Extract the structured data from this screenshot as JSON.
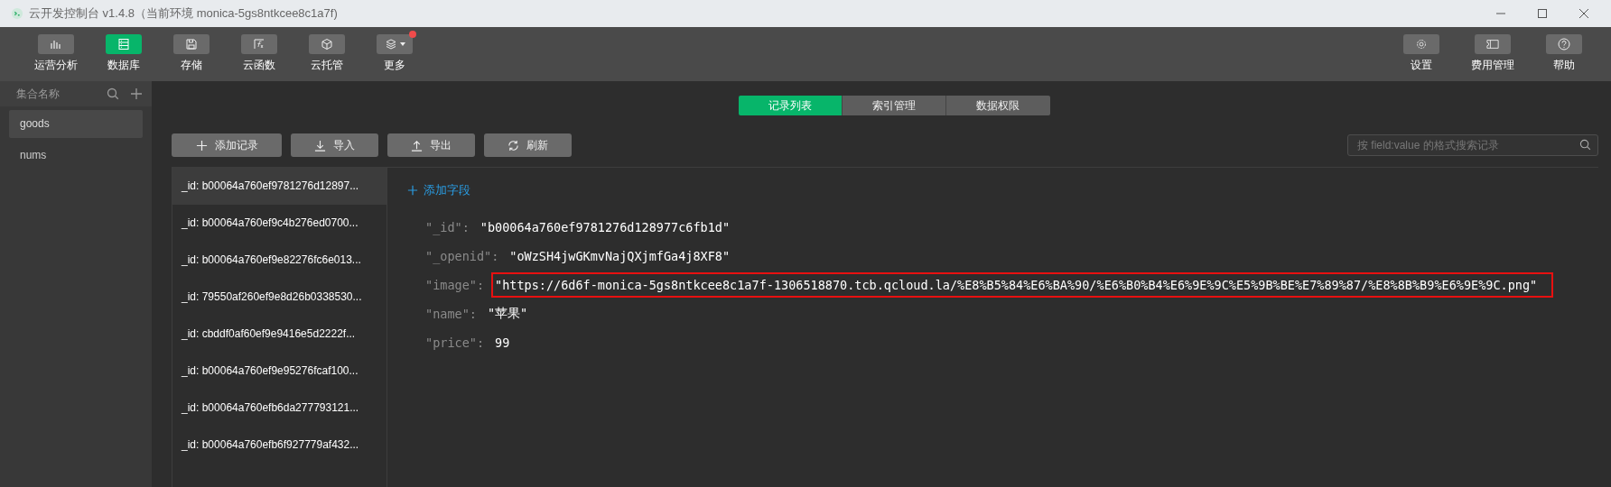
{
  "window": {
    "title": "云开发控制台 v1.4.8（当前环境 monica-5gs8ntkcee8c1a7f)"
  },
  "toolbar": {
    "left": [
      {
        "label": "运营分析",
        "selected": false,
        "badge": false,
        "dropdown": false
      },
      {
        "label": "数据库",
        "selected": true,
        "badge": false,
        "dropdown": false
      },
      {
        "label": "存储",
        "selected": false,
        "badge": false,
        "dropdown": false
      },
      {
        "label": "云函数",
        "selected": false,
        "badge": false,
        "dropdown": false
      },
      {
        "label": "云托管",
        "selected": false,
        "badge": false,
        "dropdown": false
      },
      {
        "label": "更多",
        "selected": false,
        "badge": true,
        "dropdown": true
      }
    ],
    "right": [
      {
        "label": "设置",
        "selected": false
      },
      {
        "label": "费用管理",
        "selected": false
      },
      {
        "label": "帮助",
        "selected": false
      }
    ]
  },
  "sidebar": {
    "title": "集合名称",
    "items": [
      {
        "label": "goods",
        "selected": true
      },
      {
        "label": "nums",
        "selected": false
      }
    ]
  },
  "tabs": [
    {
      "label": "记录列表",
      "selected": true
    },
    {
      "label": "索引管理",
      "selected": false
    },
    {
      "label": "数据权限",
      "selected": false
    }
  ],
  "actions": [
    {
      "label": "添加记录"
    },
    {
      "label": "导入"
    },
    {
      "label": "导出"
    },
    {
      "label": "刷新"
    }
  ],
  "search": {
    "placeholder": "按 field:value 的格式搜索记录"
  },
  "records": [
    {
      "label": "_id: b00064a760ef9781276d12897...",
      "selected": true
    },
    {
      "label": "_id: b00064a760ef9c4b276ed0700...",
      "selected": false
    },
    {
      "label": "_id: b00064a760ef9e82276fc6e013...",
      "selected": false
    },
    {
      "label": "_id: 79550af260ef9e8d26b0338530...",
      "selected": false
    },
    {
      "label": "_id: cbddf0af60ef9e9416e5d2222f...",
      "selected": false
    },
    {
      "label": "_id: b00064a760ef9e95276fcaf100...",
      "selected": false
    },
    {
      "label": "_id: b00064a760efb6da277793121...",
      "selected": false
    },
    {
      "label": "_id: b00064a760efb6f927779af432...",
      "selected": false
    }
  ],
  "detail": {
    "add_field": "添加字段",
    "fields": [
      {
        "key": "\"_id\":",
        "value": "\"b00064a760ef9781276d128977c6fb1d\"",
        "highlighted": false
      },
      {
        "key": "\"_openid\":",
        "value": "\"oWzSH4jwGKmvNajQXjmfGa4j8XF8\"",
        "highlighted": false
      },
      {
        "key": "\"image\":",
        "value": "\"https://6d6f-monica-5gs8ntkcee8c1a7f-1306518870.tcb.qcloud.la/%E8%B5%84%E6%BA%90/%E6%B0%B4%E6%9E%9C%E5%9B%BE%E7%89%87/%E8%8B%B9%E6%9E%9C.png\"",
        "highlighted": true
      },
      {
        "key": "\"name\":",
        "value": "\"苹果\"",
        "highlighted": false
      },
      {
        "key": "\"price\":",
        "value": "99",
        "highlighted": false
      }
    ]
  }
}
